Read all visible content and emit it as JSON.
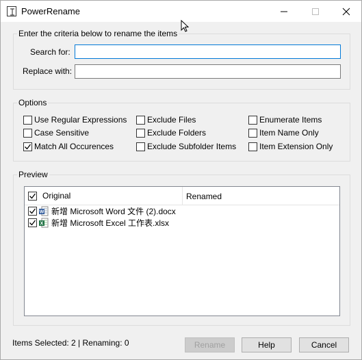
{
  "window": {
    "title": "PowerRename"
  },
  "criteria": {
    "legend": "Enter the criteria below to rename the items",
    "search_label": "Search for:",
    "search_value": "",
    "replace_label": "Replace with:",
    "replace_value": ""
  },
  "options": {
    "legend": "Options",
    "items": [
      {
        "label": "Use Regular Expressions",
        "checked": false
      },
      {
        "label": "Case Sensitive",
        "checked": false
      },
      {
        "label": "Match All Occurences",
        "checked": true
      },
      {
        "label": "Exclude Files",
        "checked": false
      },
      {
        "label": "Exclude Folders",
        "checked": false
      },
      {
        "label": "Exclude Subfolder Items",
        "checked": false
      },
      {
        "label": "Enumerate Items",
        "checked": false
      },
      {
        "label": "Item Name Only",
        "checked": false
      },
      {
        "label": "Item Extension Only",
        "checked": false
      }
    ]
  },
  "preview": {
    "legend": "Preview",
    "columns": {
      "original": "Original",
      "renamed": "Renamed"
    },
    "header_checked": true,
    "rows": [
      {
        "name": "新增 Microsoft Word 文件 (2).docx",
        "icon": "word-file-icon",
        "checked": true,
        "renamed": ""
      },
      {
        "name": "新增 Microsoft Excel 工作表.xlsx",
        "icon": "excel-file-icon",
        "checked": true,
        "renamed": ""
      }
    ]
  },
  "status": {
    "text": "Items Selected: 2 | Renaming: 0"
  },
  "buttons": {
    "rename": "Rename",
    "help": "Help",
    "cancel": "Cancel"
  },
  "colors": {
    "accent": "#0078d7",
    "word": "#2b579a",
    "excel": "#217346"
  }
}
